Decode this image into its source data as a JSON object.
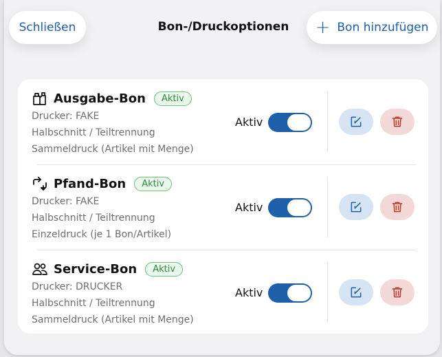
{
  "header": {
    "close_label": "Schließen",
    "title": "Bon-/Druckoptionen",
    "add_label": "Bon hinzufügen"
  },
  "colors": {
    "accent": "#1d5fa8",
    "active_green": "#2e8b3d",
    "delete_red": "#c0392b"
  },
  "rows": [
    {
      "icon": "receipt-bag-icon",
      "name": "Ausgabe-Bon",
      "badge": "Aktiv",
      "details": [
        "Drucker: FAKE",
        "Halbschnitt / Teiltrennung",
        "Sammeldruck (Artikel mit Menge)"
      ],
      "toggle_label": "Aktiv",
      "toggle_on": true
    },
    {
      "icon": "swap-arrows-icon",
      "name": "Pfand-Bon",
      "badge": "Aktiv",
      "details": [
        "Drucker: FAKE",
        "Halbschnitt / Teiltrennung",
        "Einzeldruck (je 1 Bon/Artikel)"
      ],
      "toggle_label": "Aktiv",
      "toggle_on": true
    },
    {
      "icon": "people-icon",
      "name": "Service-Bon",
      "badge": "Aktiv",
      "details": [
        "Drucker: DRUCKER",
        "Halbschnitt / Teiltrennung",
        "Sammeldruck (Artikel mit Menge)"
      ],
      "toggle_label": "Aktiv",
      "toggle_on": true
    }
  ]
}
